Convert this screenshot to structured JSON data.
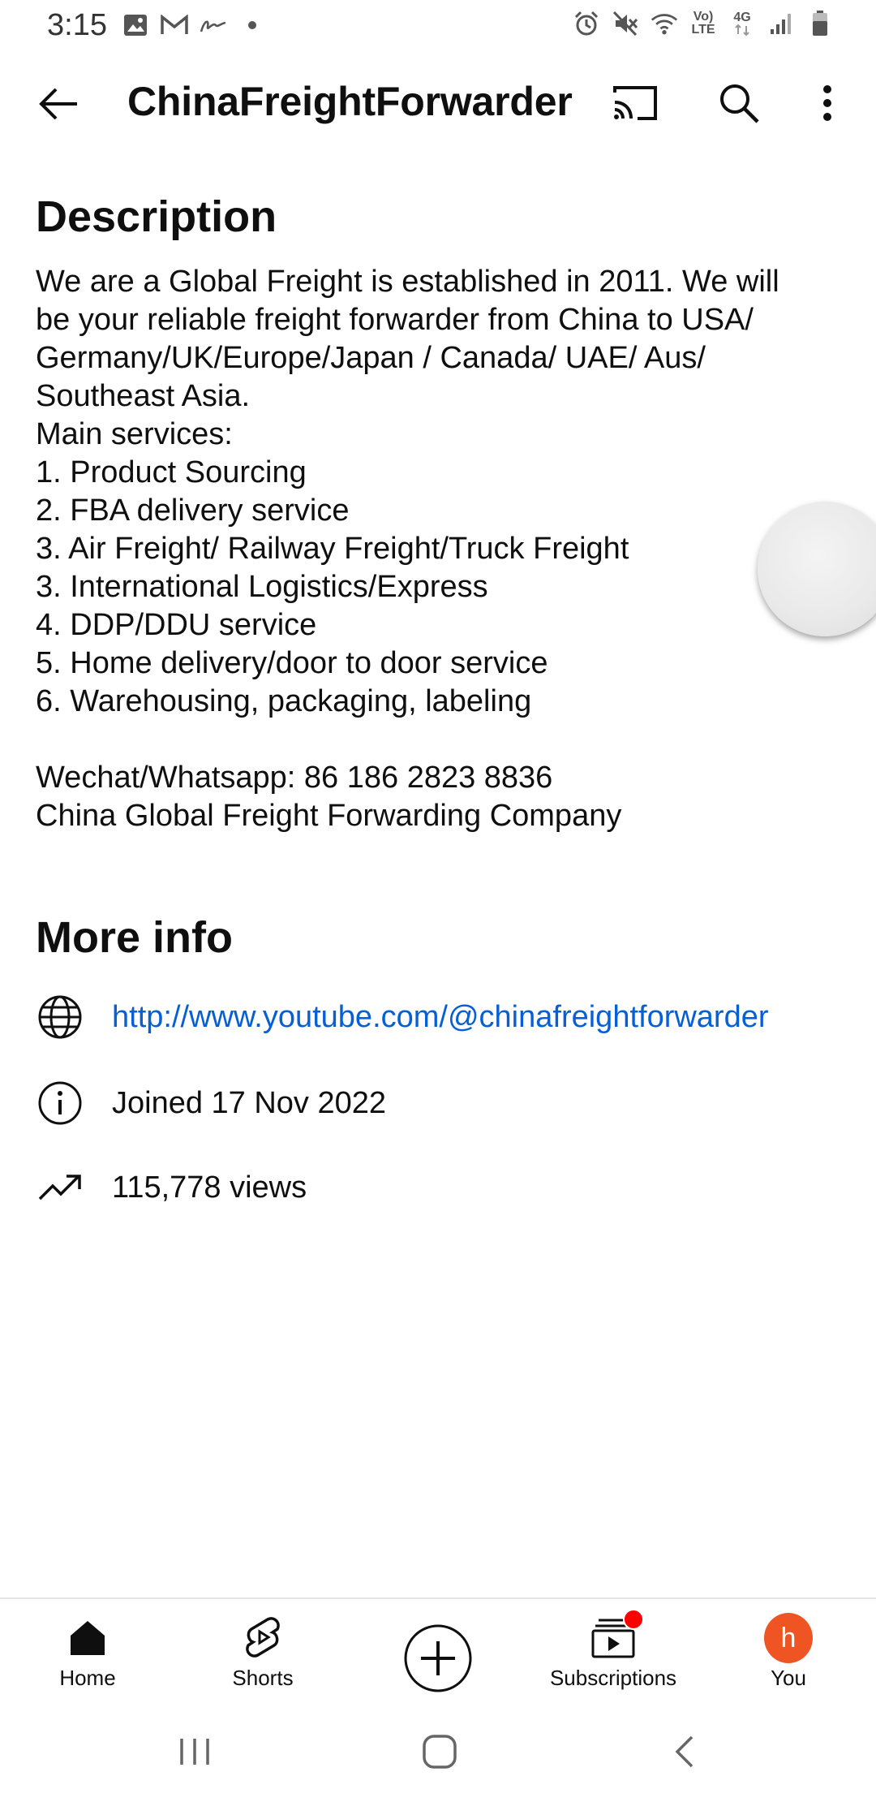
{
  "status_bar": {
    "time": "3:15",
    "left_icons": [
      "image-icon",
      "gmail-icon",
      "signature-icon",
      "dot-icon"
    ],
    "right_icons": [
      "alarm-icon",
      "mute-icon",
      "wifi-icon",
      "volte-icon",
      "4g-icon",
      "signal-icon",
      "battery-icon"
    ],
    "volte_label_top": "Vo)",
    "volte_label_bottom": "LTE",
    "network_label": "4G"
  },
  "app_bar": {
    "title": "ChinaFreightForwarder",
    "icons": [
      "back-arrow-icon",
      "cast-icon",
      "search-icon",
      "more-vert-icon"
    ]
  },
  "description": {
    "title": "Description",
    "lines": [
      "We are a Global Freight is established in 2011. We will",
      "be your reliable freight forwarder from China to USA/",
      "Germany/UK/Europe/Japan / Canada/ UAE/ Aus/",
      "Southeast Asia.",
      "Main services:",
      "1. Product Sourcing",
      "2. FBA delivery service",
      "3. Air Freight/ Railway Freight/Truck Freight",
      "3. International Logistics/Express",
      "4. DDP/DDU service",
      "5. Home delivery/door to door service",
      "6. Warehousing, packaging, labeling",
      "",
      "Wechat/Whatsapp: 86 186 2823 8836",
      "China Global Freight Forwarding Company"
    ]
  },
  "more_info": {
    "title": "More info",
    "link": "http://www.youtube.com/@chinafreightforwarder",
    "joined": "Joined 17 Nov 2022",
    "views": "115,778 views"
  },
  "bottom_nav": {
    "items": [
      {
        "label": "Home",
        "icon": "home-icon"
      },
      {
        "label": "Shorts",
        "icon": "shorts-icon"
      },
      {
        "label": "",
        "icon": "create-plus-icon"
      },
      {
        "label": "Subscriptions",
        "icon": "subscriptions-icon"
      },
      {
        "label": "You",
        "icon": "avatar"
      }
    ],
    "avatar_letter": "h"
  },
  "colors": {
    "link": "#065fd4",
    "avatar": "#ef5423",
    "notification": "#ff0000",
    "text": "#0f0f0f"
  }
}
